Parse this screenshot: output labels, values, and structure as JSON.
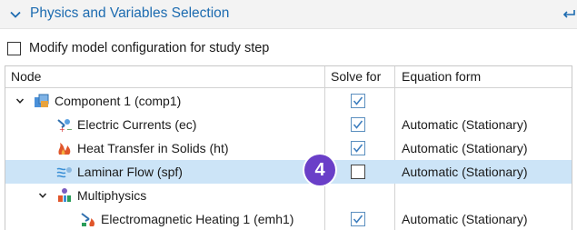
{
  "section": {
    "title": "Physics and Variables Selection"
  },
  "modify_checkbox": {
    "label": "Modify model configuration for study step",
    "checked": false
  },
  "table": {
    "headers": {
      "node": "Node",
      "solve_for": "Solve for",
      "equation_form": "Equation form"
    },
    "rows": [
      {
        "label": "Component 1 (comp1)",
        "icon": "component-icon",
        "expanded": true,
        "solve_for": true,
        "equation_form": ""
      },
      {
        "label": "Electric Currents (ec)",
        "icon": "electric-currents-icon",
        "solve_for": true,
        "equation_form": "Automatic (Stationary)"
      },
      {
        "label": "Heat Transfer in Solids (ht)",
        "icon": "heat-transfer-icon",
        "solve_for": true,
        "equation_form": "Automatic (Stationary)"
      },
      {
        "label": "Laminar Flow (spf)",
        "icon": "laminar-flow-icon",
        "solve_for": false,
        "equation_form": "Automatic (Stationary)",
        "selected": true
      },
      {
        "label": "Multiphysics",
        "icon": "multiphysics-icon",
        "expanded": true,
        "solve_for": null,
        "equation_form": ""
      },
      {
        "label": "Electromagnetic Heating 1 (emh1)",
        "icon": "electromagnetic-heating-icon",
        "solve_for": true,
        "equation_form": "Automatic (Stationary)"
      }
    ]
  },
  "callout": {
    "number": "4"
  },
  "colors": {
    "title_blue": "#1c6bb0",
    "selected_row": "#cce4f7",
    "badge_purple": "#6a3fc8",
    "checkbox_blue": "#5b8fbf"
  }
}
